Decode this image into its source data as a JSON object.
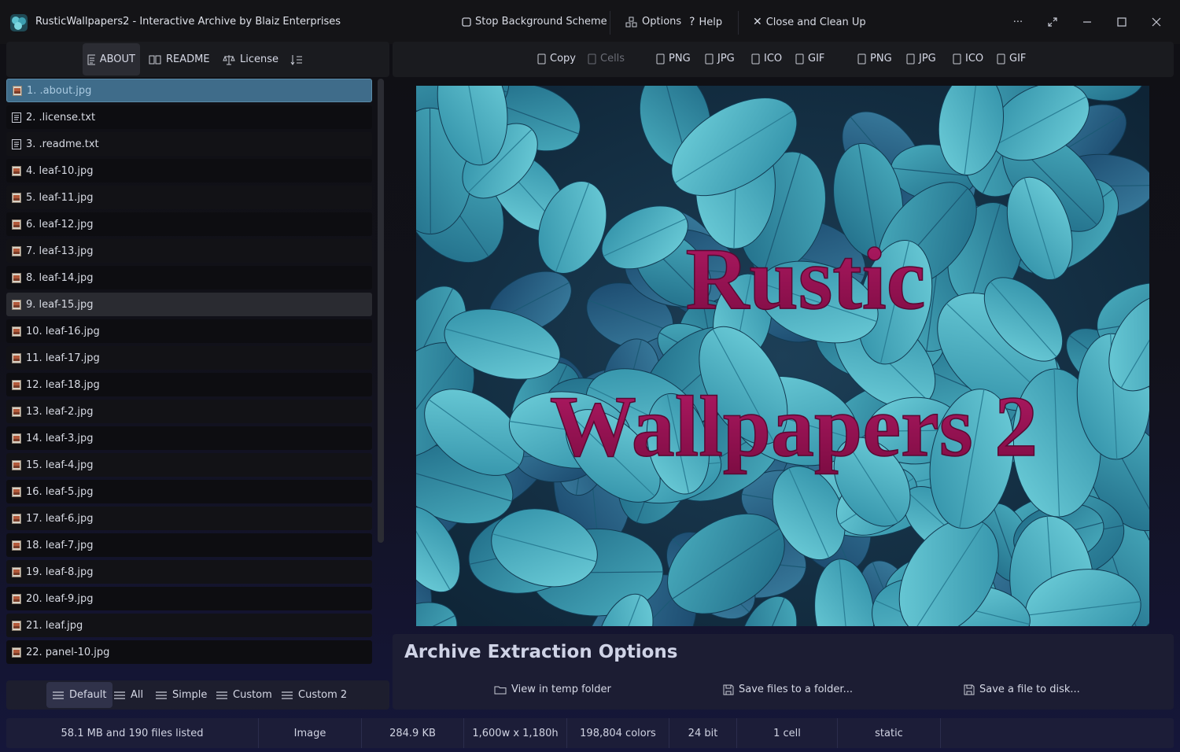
{
  "titlebar": {
    "app_name": "RusticWallpapers2",
    "subtitle": " -  Interactive Archive by Blaiz Enterprises",
    "stop_bg": "Stop Background Scheme",
    "options": "Options",
    "help": "Help",
    "close_cleanup": "Close and Clean Up"
  },
  "left_tabs": {
    "about": "ABOUT",
    "readme": "README",
    "license": "License"
  },
  "copy_toolbar": {
    "copy": "Copy",
    "cells": "Cells",
    "group1": [
      "PNG",
      "JPG",
      "ICO",
      "GIF"
    ],
    "group2": [
      "PNG",
      "JPG",
      "ICO",
      "GIF"
    ]
  },
  "files": [
    "1.  .about.jpg",
    "2.  .license.txt",
    "3.  .readme.txt",
    "4.  leaf-10.jpg",
    "5.  leaf-11.jpg",
    "6.  leaf-12.jpg",
    "7.  leaf-13.jpg",
    "8.  leaf-14.jpg",
    "9.  leaf-15.jpg",
    "10.  leaf-16.jpg",
    "11.  leaf-17.jpg",
    "12.  leaf-18.jpg",
    "13.  leaf-2.jpg",
    "14.  leaf-3.jpg",
    "15.  leaf-4.jpg",
    "16.  leaf-5.jpg",
    "17.  leaf-6.jpg",
    "18.  leaf-7.jpg",
    "19.  leaf-8.jpg",
    "20.  leaf-9.jpg",
    "21.  leaf.jpg",
    "22.  panel-10.jpg"
  ],
  "file_types": [
    "img",
    "txt",
    "txt",
    "img",
    "img",
    "img",
    "img",
    "img",
    "img",
    "img",
    "img",
    "img",
    "img",
    "img",
    "img",
    "img",
    "img",
    "img",
    "img",
    "img",
    "img",
    "img"
  ],
  "view_tabs": {
    "default": "Default",
    "all": "All",
    "simple": "Simple",
    "custom": "Custom",
    "custom2": "Custom 2"
  },
  "preview": {
    "line1": "Rustic",
    "line2": "Wallpapers 2"
  },
  "extraction": {
    "title": "Archive Extraction Options",
    "view_temp": "View in temp folder",
    "save_folder": "Save files to a folder...",
    "save_file": "Save a file to disk..."
  },
  "status": {
    "listing": "58.1 MB and 190 files listed",
    "type": "Image",
    "size": "284.9 KB",
    "dimensions": "1,600w x 1,180h",
    "colors": "198,804 colors",
    "bits": "24 bit",
    "cells": "1 cell",
    "mode": "static"
  },
  "colors": {
    "accent": "#3f6c8a",
    "title_magenta": "#9b1355",
    "leaf_teal": "#4fb3c4"
  }
}
